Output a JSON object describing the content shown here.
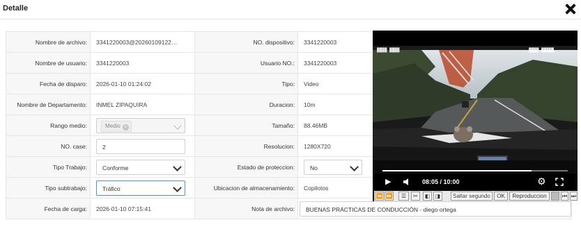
{
  "header": {
    "title": "Detalle"
  },
  "left": {
    "filename_label": "Nombre de archivo:",
    "filename_value": "3341220003@20260109122…",
    "username_label": "Nombre de usuario:",
    "username_value": "3341220003",
    "trigger_date_label": "Fecha de disparo:",
    "trigger_date_value": "2026-01-10 01:24:02",
    "department_label": "Nombre de Departamento:",
    "department_value": "INMEL ZIPAQUIRA",
    "range_label": "Rango medio:",
    "range_tag": "Medio",
    "case_label": "NO. case:",
    "case_value": "2",
    "work_type_label": "Tipo Trabajo:",
    "work_type_value": "Conforme",
    "subwork_type_label": "Tipo subtrabajo:",
    "subwork_type_value": "Tráfico",
    "upload_date_label": "Fecha de carga:",
    "upload_date_value": "2026-01-10 07:15:41"
  },
  "right": {
    "device_label": "NO. dispositivo:",
    "device_value": "3341220003",
    "user_no_label": "Usuario NO.:",
    "user_no_value": "3341220003",
    "type_label": "Tipo:",
    "type_value": "Video",
    "duration_label": "Duracion:",
    "duration_value": "10m",
    "size_label": "Tamaño:",
    "size_value": "88.46MB",
    "resolution_label": "Resolucion:",
    "resolution_value": "1280X720",
    "protection_label": "Estado de proteccion:",
    "protection_value": "No",
    "storage_label": "Ubicacion de almacenamiento:",
    "storage_value": "Copilotos",
    "note_label": "Nota de archivo:",
    "note_value": "BUENAS PRÁCTICAS DE CONDUCCIÓN - diego ortega"
  },
  "video": {
    "time": "08:05 / 10:00",
    "progress": 0.805,
    "seek_placeholder": "Saltar segundo",
    "ok_label": "OK",
    "playback_label": "Reproduccion"
  },
  "icons": {
    "close": "close-icon",
    "play": "play-icon",
    "volume": "volume-icon",
    "settings": "gear-icon",
    "fullscreen": "fullscreen-icon"
  }
}
